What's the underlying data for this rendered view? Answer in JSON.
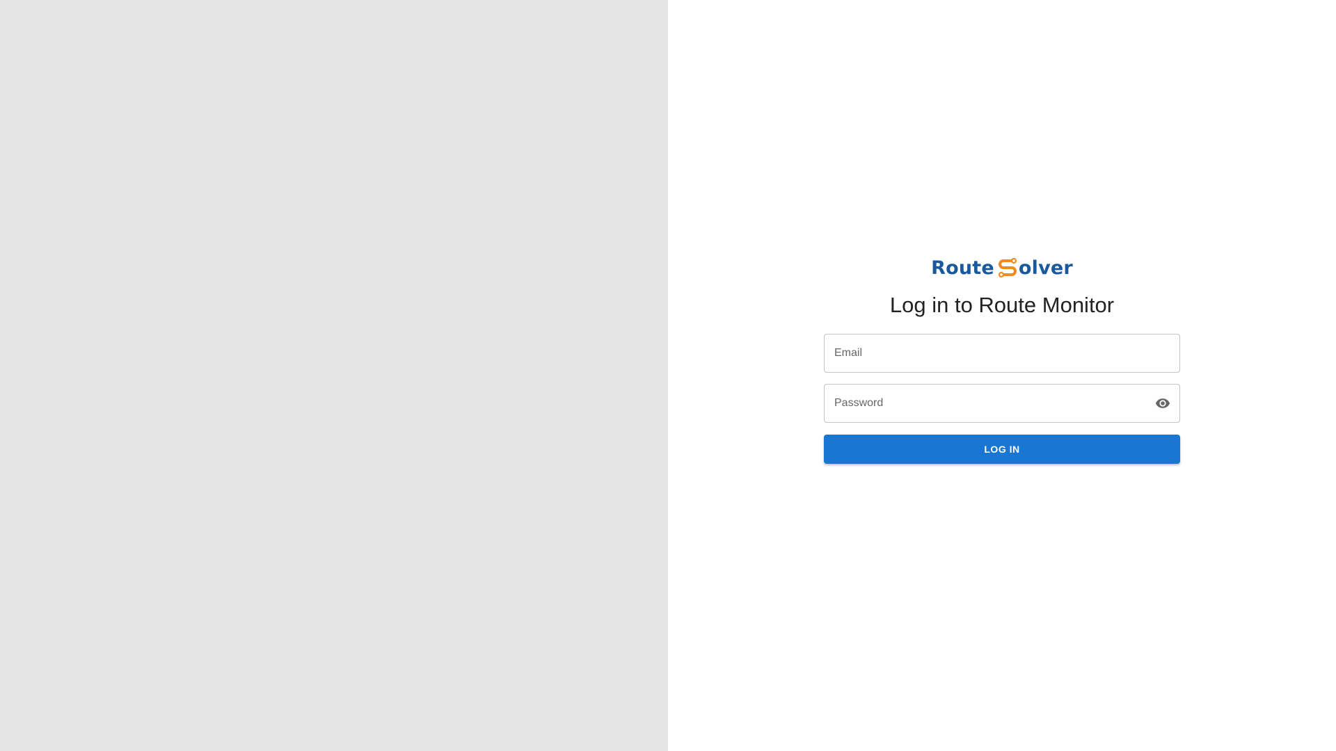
{
  "logo": {
    "text_a": "Route",
    "text_b": "olver",
    "mark_icon": "route-s-icon",
    "color_text": "#1a5a9c",
    "color_mark": "#f28a1e"
  },
  "login": {
    "title": "Log in to Route Monitor",
    "email_placeholder": "Email",
    "password_placeholder": "Password",
    "toggle_icon": "eye-icon",
    "button_label": "LOG IN"
  },
  "colors": {
    "left_panel": "#e5e5e5",
    "primary": "#1976d2"
  }
}
